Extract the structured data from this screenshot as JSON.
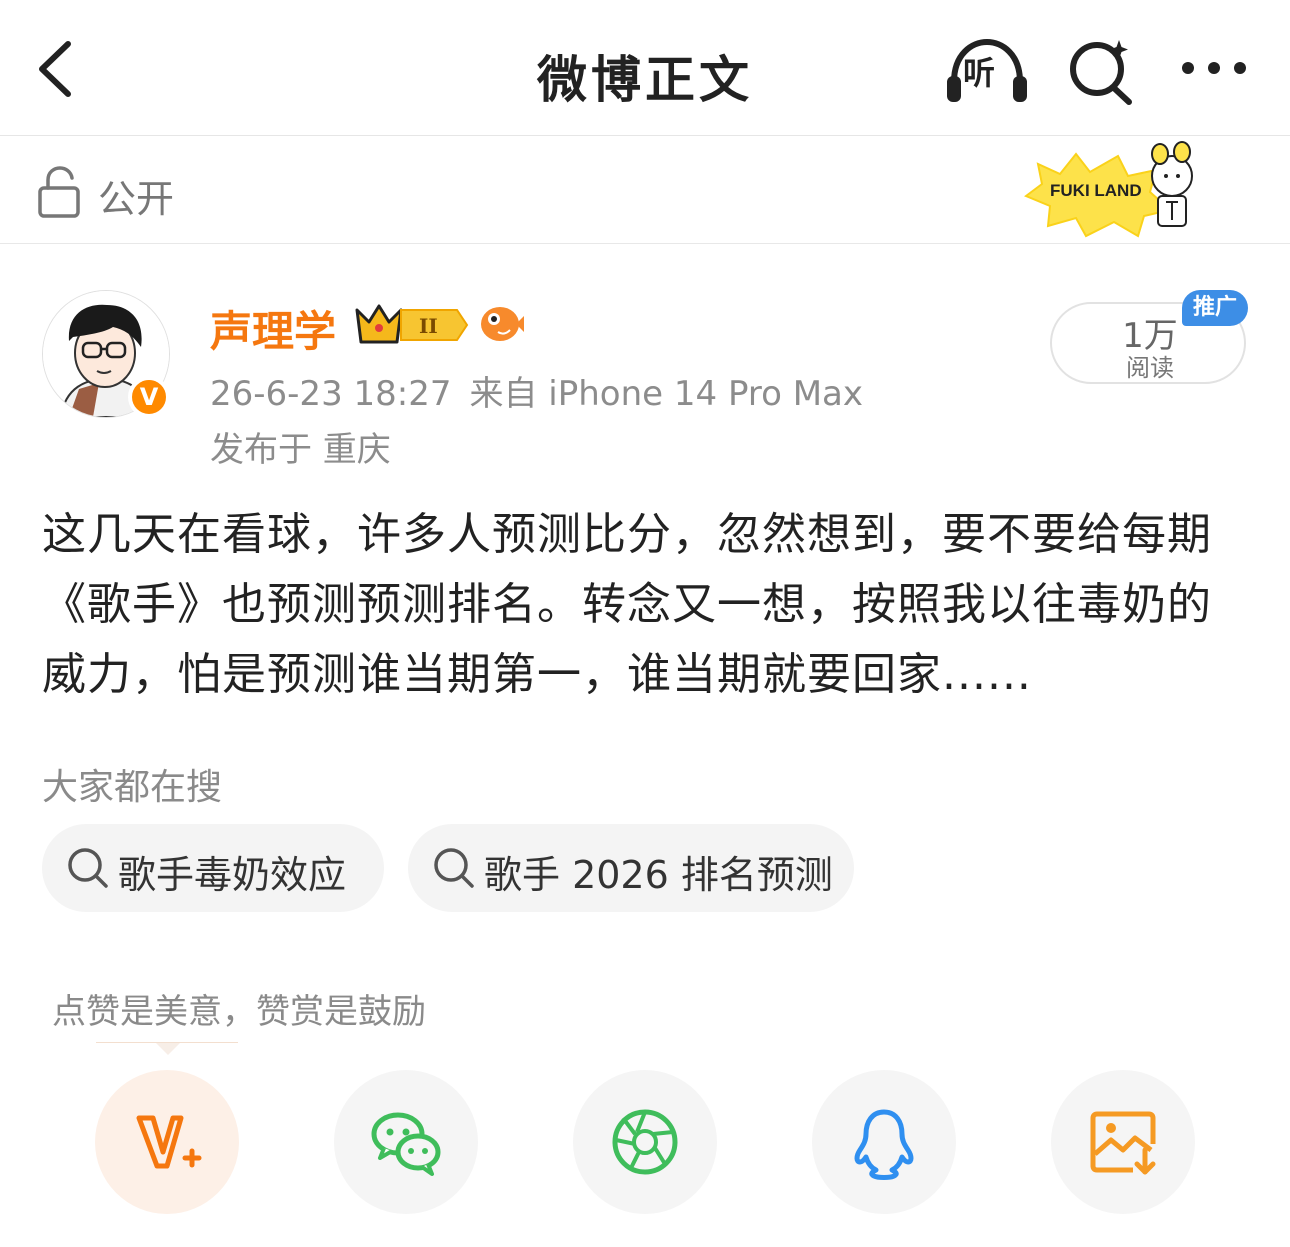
{
  "header": {
    "title": "微博正文",
    "listen_label": "听"
  },
  "privacy": {
    "label": "公开",
    "sticker_text": "FUKI LAND"
  },
  "post": {
    "author": "声理学",
    "time": "26-6-23 18:27",
    "source": "来自 iPhone 14 Pro Max",
    "location": "发布于 重庆",
    "reads": "1万",
    "reads_label": "阅读",
    "promo_label": "推广",
    "verified_badge": "V",
    "level_badge": "II",
    "text": "这几天在看球，许多人预测比分，忽然想到，要不要给每期《歌手》也预测预测排名。转念又一想，按照我以往毒奶的威力，怕是预测谁当期第一，谁当期就要回家......"
  },
  "search_section": {
    "title": "大家都在搜",
    "chips": [
      "歌手毒奶效应",
      "歌手 2026 排名预测"
    ]
  },
  "reward": {
    "tip": "点赞是美意，赞赏是鼓励"
  },
  "share_icons": [
    "reward-v-plus-icon",
    "wechat-icon",
    "moments-icon",
    "qq-icon",
    "save-image-icon"
  ],
  "colors": {
    "accent_orange": "#f5770f",
    "promo_blue": "#3d8ee6",
    "wechat_green": "#3fbd5b",
    "qq_blue": "#2f8ff0",
    "save_orange": "#f59a23"
  }
}
